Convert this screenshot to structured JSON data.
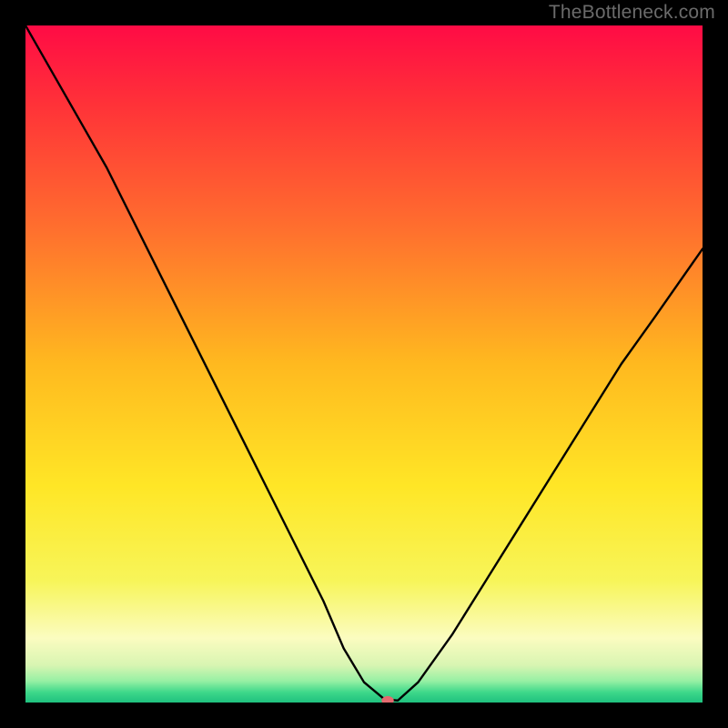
{
  "watermark": "TheBottleneck.com",
  "chart_data": {
    "type": "line",
    "title": "",
    "xlabel": "",
    "ylabel": "",
    "xlim": [
      0,
      100
    ],
    "ylim": [
      0,
      100
    ],
    "grid": false,
    "legend": false,
    "background_gradient": {
      "stops": [
        {
          "offset": 0.0,
          "color": "#ff0b45"
        },
        {
          "offset": 0.12,
          "color": "#ff3338"
        },
        {
          "offset": 0.3,
          "color": "#ff6f2e"
        },
        {
          "offset": 0.5,
          "color": "#ffb91f"
        },
        {
          "offset": 0.68,
          "color": "#ffe626"
        },
        {
          "offset": 0.82,
          "color": "#f7f559"
        },
        {
          "offset": 0.905,
          "color": "#fbfcc0"
        },
        {
          "offset": 0.945,
          "color": "#d8f5b2"
        },
        {
          "offset": 0.968,
          "color": "#97f0a4"
        },
        {
          "offset": 0.985,
          "color": "#3dd88a"
        },
        {
          "offset": 1.0,
          "color": "#1fc17f"
        }
      ]
    },
    "series": [
      {
        "name": "bottleneck-curve",
        "color": "#000000",
        "stroke_width": 2.4,
        "x": [
          0,
          4,
          8,
          12,
          16,
          20,
          24,
          28,
          32,
          36,
          40,
          44,
          47,
          50,
          53,
          55,
          58,
          63,
          68,
          73,
          78,
          83,
          88,
          93,
          100
        ],
        "values": [
          100,
          93,
          86,
          79,
          71,
          63,
          55,
          47,
          39,
          31,
          23,
          15,
          8,
          3,
          0.5,
          0.3,
          3,
          10,
          18,
          26,
          34,
          42,
          50,
          57,
          67
        ]
      }
    ],
    "marker": {
      "name": "optimal-point",
      "x": 53.5,
      "y": 0.3,
      "rx": 0.9,
      "ry": 0.65,
      "fill": "#e46a6f"
    }
  }
}
